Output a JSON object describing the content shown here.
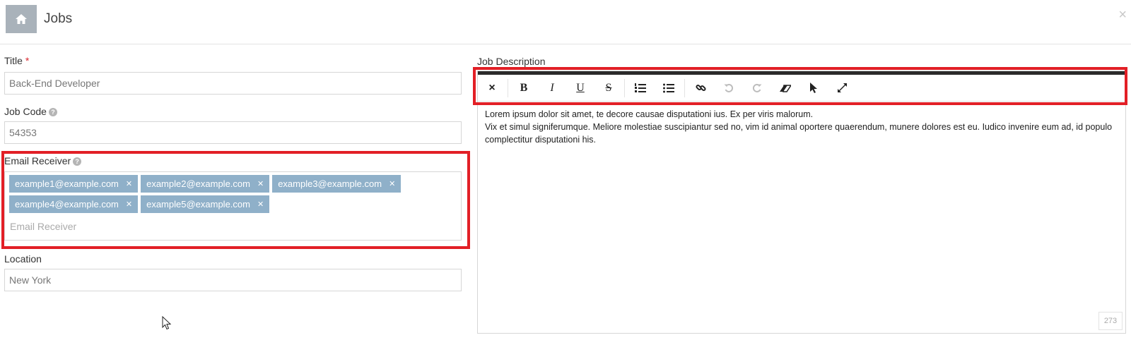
{
  "header": {
    "title": "Jobs",
    "close_glyph": "×"
  },
  "form": {
    "title_label": "Title",
    "title_required": "*",
    "title_value": "Back-End Developer",
    "job_code_label": "Job Code",
    "job_code_value": "54353",
    "email_label": "Email Receiver",
    "email_tags": [
      "example1@example.com",
      "example2@example.com",
      "example3@example.com",
      "example4@example.com",
      "example5@example.com"
    ],
    "email_placeholder": "Email Receiver",
    "location_label": "Location",
    "location_value": "New York",
    "help_glyph": "?"
  },
  "editor": {
    "label": "Job Description",
    "toolbar": {
      "clear": "×",
      "bold": "B",
      "italic": "I",
      "underline": "U",
      "strike": "S"
    },
    "lines": [
      "Lorem ipsum dolor sit amet, te decore causae disputationi ius. Ex per viris malorum.",
      "Vix et simul signiferumque. Meliore molestiae suscipiantur sed no, vim id animal oportere quaerendum, munere dolores est eu. Iudico invenire eum ad, id populo complectitur disputationi his."
    ],
    "char_count": "273"
  },
  "icons": {
    "home": "home-icon",
    "help": "help-icon",
    "remove": "remove-tag-icon",
    "ordered_list": "ordered-list-icon",
    "unordered_list": "unordered-list-icon",
    "link": "link-icon",
    "undo": "undo-icon",
    "redo": "redo-icon",
    "eraser": "eraser-icon",
    "pointer": "pointer-icon",
    "fullscreen": "fullscreen-icon",
    "cursor": "mouse-cursor-icon"
  },
  "colors": {
    "tag_bg": "#8fb0c9",
    "highlight": "#e21f26",
    "home_bg": "#a9b2ba"
  }
}
